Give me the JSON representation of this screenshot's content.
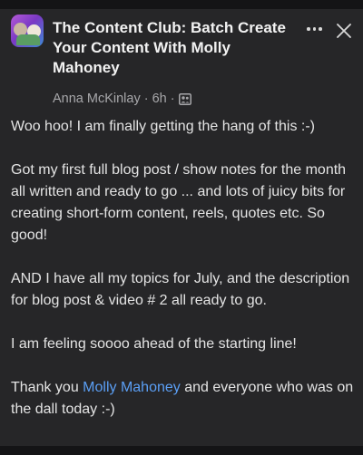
{
  "post": {
    "group_title": "The Content Club: Batch Create Your Content With Molly Mahoney",
    "author": "Anna McKinlay",
    "time": "6h",
    "paragraphs": [
      "Woo hoo! I am finally getting the hang of this :-)",
      "Got my first full blog post / show notes for the month all written and ready to go ... and lots of juicy bits for creating short-form content, reels, quotes etc. So good!",
      "AND I have all my topics for July, and the description for blog post & video # 2 all ready to go.",
      "I am feeling soooo ahead of the starting line!"
    ],
    "last_paragraph": {
      "before": "Thank you ",
      "mention": "Molly Mahoney",
      "after": " and everyone who was on the dall today :-)"
    }
  },
  "icons": {
    "more": "more-horizontal-icon",
    "close": "close-icon",
    "audience": "group-audience-icon"
  },
  "colors": {
    "background": "#262628",
    "mention": "#5b9ff5",
    "meta": "#a7a7aa"
  }
}
